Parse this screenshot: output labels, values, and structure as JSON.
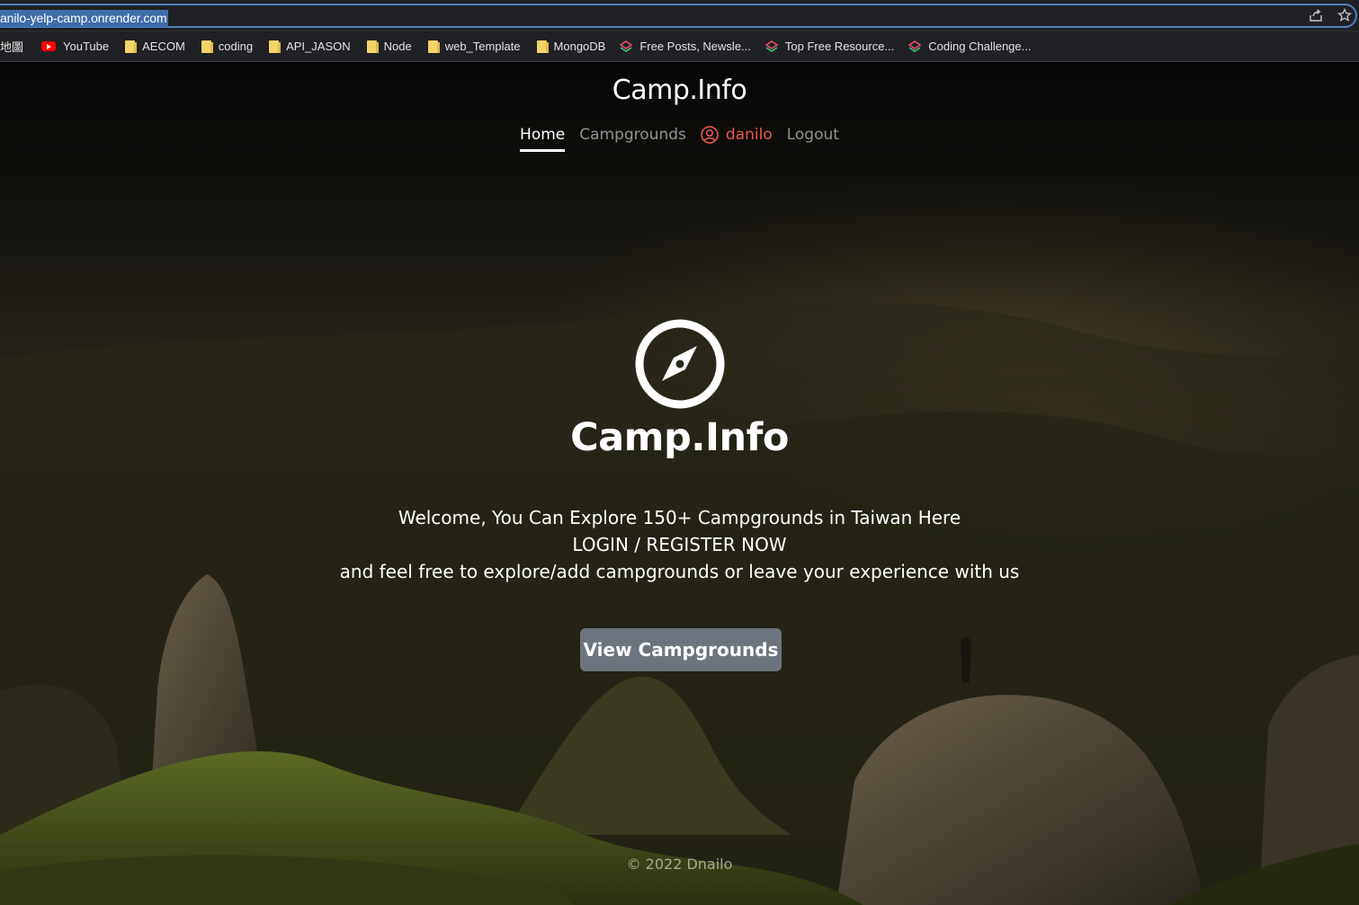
{
  "browser": {
    "url": "anilo-yelp-camp.onrender.com",
    "bookmarks": [
      {
        "label": "地圖",
        "icon": "map-icon"
      },
      {
        "label": "YouTube",
        "icon": "youtube-icon"
      },
      {
        "label": "AECOM",
        "icon": "folder-icon"
      },
      {
        "label": "coding",
        "icon": "folder-icon"
      },
      {
        "label": "API_JASON",
        "icon": "folder-icon"
      },
      {
        "label": "Node",
        "icon": "folder-icon"
      },
      {
        "label": "web_Template",
        "icon": "folder-icon"
      },
      {
        "label": "MongoDB",
        "icon": "folder-icon"
      },
      {
        "label": "Free Posts, Newsle...",
        "icon": "gem-icon"
      },
      {
        "label": "Top Free Resource...",
        "icon": "gem-icon"
      },
      {
        "label": "Coding Challenge...",
        "icon": "gem-icon"
      }
    ]
  },
  "site": {
    "title": "Camp.Info",
    "nav": {
      "home": "Home",
      "campgrounds": "Campgrounds",
      "user": "danilo",
      "logout": "Logout"
    }
  },
  "hero": {
    "icon": "compass-icon",
    "title": "Camp.Info",
    "line1": "Welcome, You Can Explore 150+ Campgrounds in Taiwan Here",
    "line2": "LOGIN / REGISTER NOW",
    "line3": "and feel free to explore/add campgrounds or leave your experience with us",
    "button": "View Campgrounds"
  },
  "footer": "© 2022 Dnailo",
  "colors": {
    "user_link": "#e8584e",
    "button_bg": "#6c757d",
    "address_highlight": "#3f6ca8"
  }
}
